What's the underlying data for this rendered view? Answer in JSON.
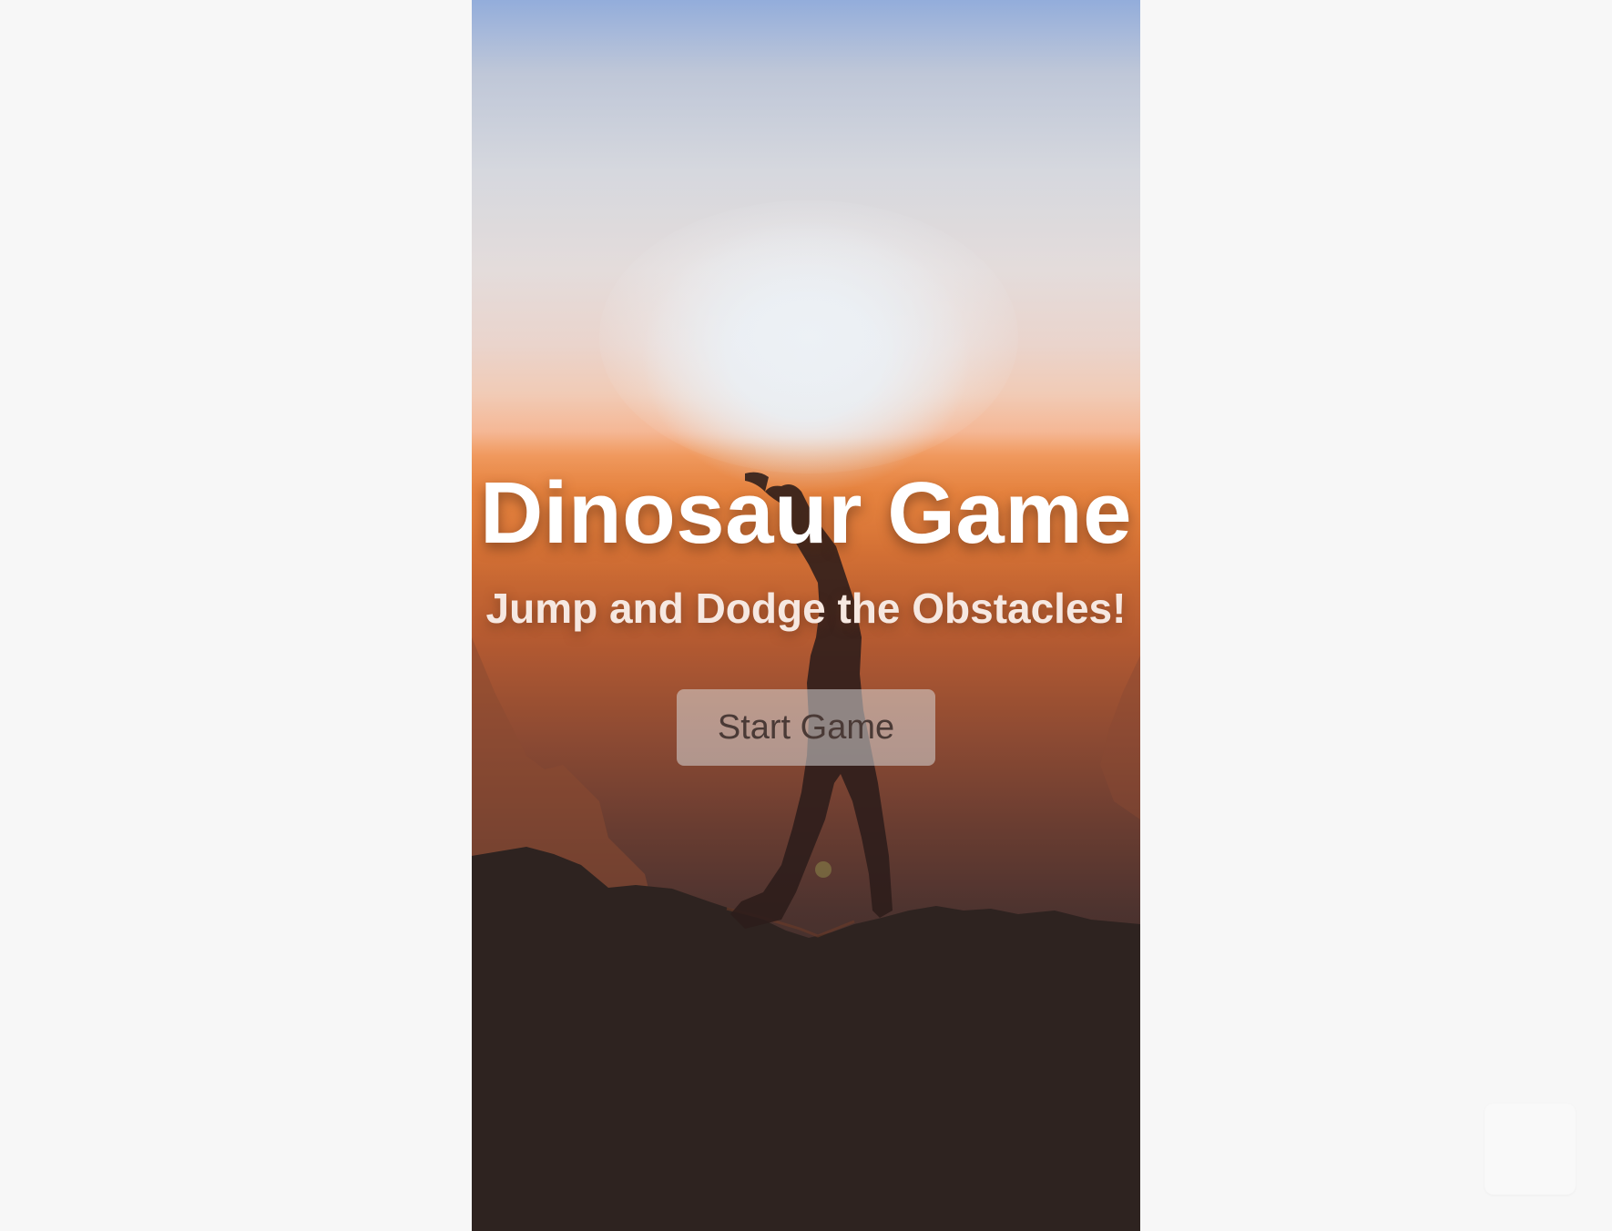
{
  "game": {
    "title": "Dinosaur Game",
    "subtitle": "Jump and Dodge the Obstacles!",
    "start_button_label": "Start Game"
  },
  "colors": {
    "page_background": "#f7f7f7",
    "sky_top": "#93addb",
    "sun_glow": "#e4e9ef",
    "horizon_orange": "#e4833f",
    "ground_dark": "#2e2523",
    "title_text": "#ffffff",
    "subtitle_text": "#f6e8e1",
    "button_text": "#4a3a36"
  },
  "background_scene": "silhouette-hiker-on-mountain-at-sunset"
}
